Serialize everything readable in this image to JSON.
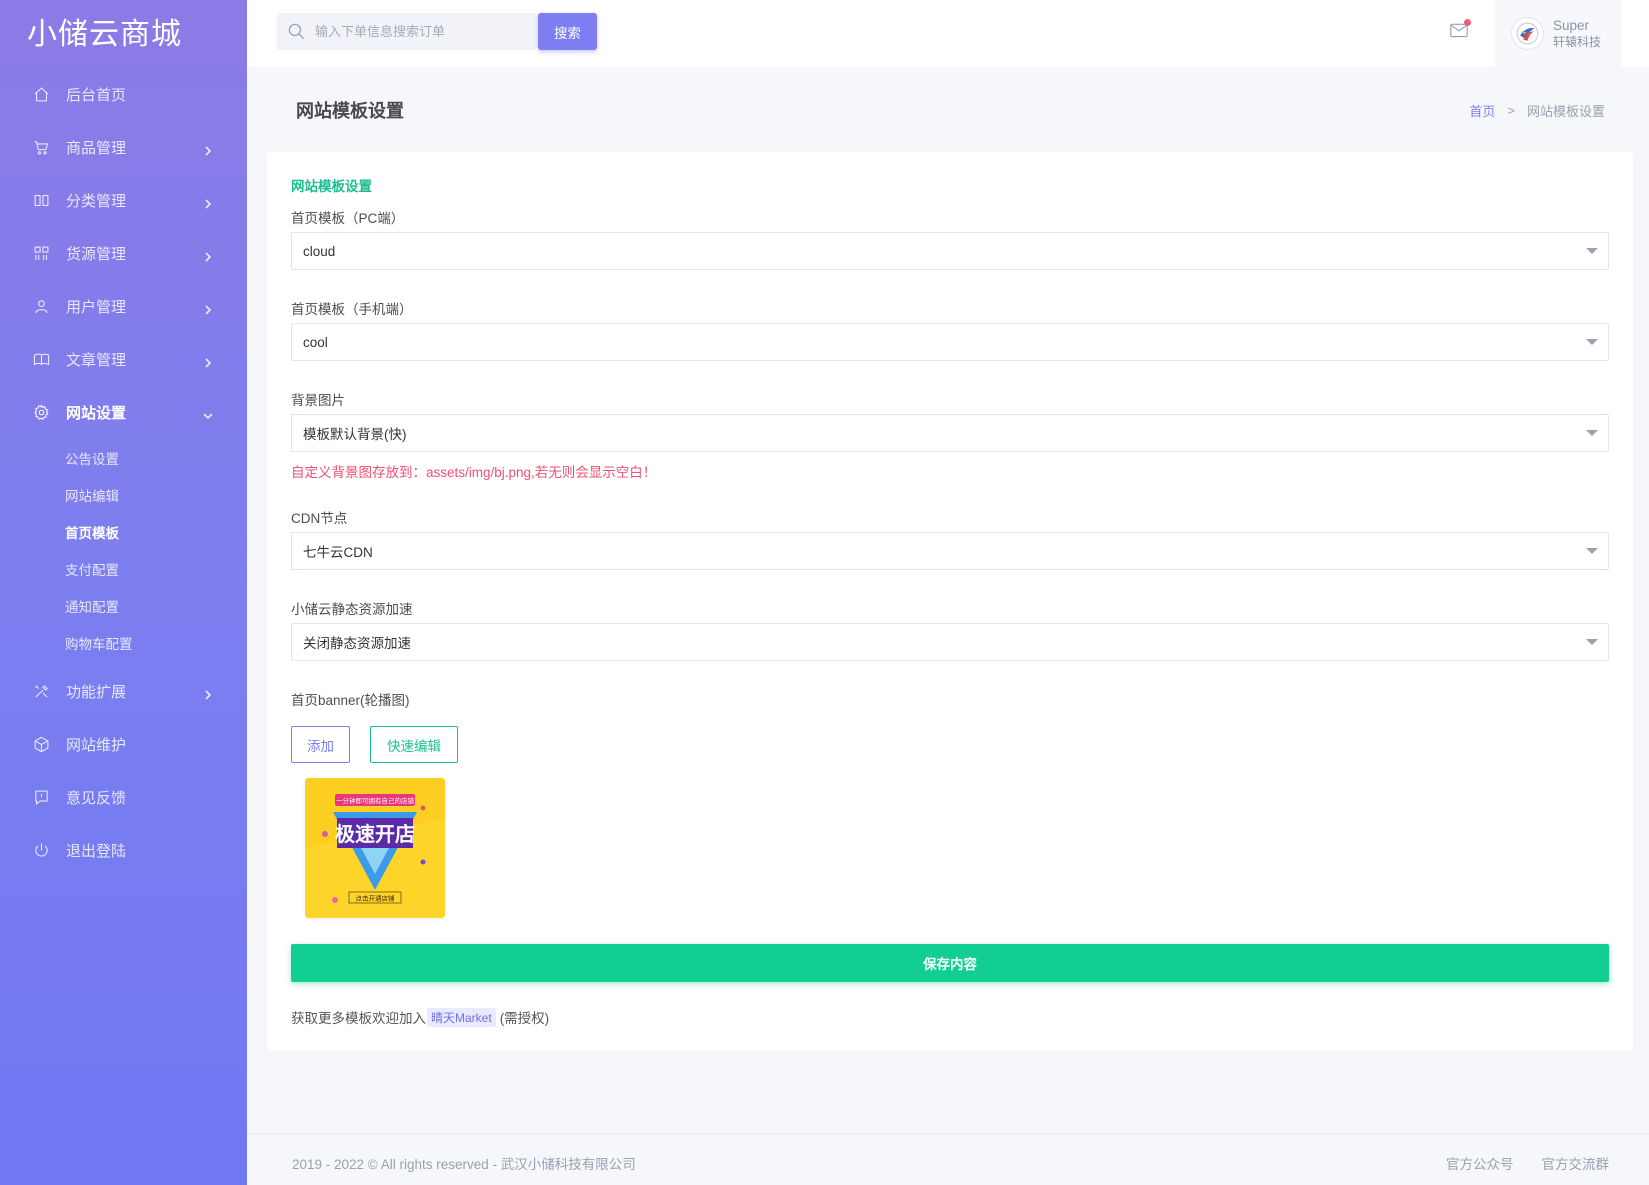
{
  "brand": "小储云商城",
  "sidebar": {
    "items": [
      {
        "label": "后台首页",
        "icon": "home-icon"
      },
      {
        "label": "商品管理",
        "icon": "cart-icon"
      },
      {
        "label": "分类管理",
        "icon": "columns-icon"
      },
      {
        "label": "货源管理",
        "icon": "grid-icon"
      },
      {
        "label": "用户管理",
        "icon": "user-icon"
      },
      {
        "label": "文章管理",
        "icon": "book-icon"
      },
      {
        "label": "网站设置",
        "icon": "gear-icon"
      },
      {
        "label": "功能扩展",
        "icon": "tools-icon"
      },
      {
        "label": "网站维护",
        "icon": "cube-icon"
      },
      {
        "label": "意见反馈",
        "icon": "feedback-icon"
      },
      {
        "label": "退出登陆",
        "icon": "power-icon"
      }
    ],
    "sub_items": [
      "公告设置",
      "网站编辑",
      "首页模板",
      "支付配置",
      "通知配置",
      "购物车配置"
    ]
  },
  "topbar": {
    "search_placeholder": "输入下单信息搜索订单",
    "search_button": "搜索",
    "user_name": "Super",
    "user_company": "轩辕科技"
  },
  "page": {
    "title": "网站模板设置",
    "breadcrumb_home": "首页",
    "breadcrumb_separator": ">",
    "breadcrumb_current": "网站模板设置"
  },
  "form": {
    "card_title": "网站模板设置",
    "pc_template_label": "首页模板（PC端）",
    "pc_template_value": "cloud",
    "mobile_template_label": "首页模板（手机端）",
    "mobile_template_value": "cool",
    "background_label": "背景图片",
    "background_value": "模板默认背景(快)",
    "background_hint": "自定义背景图存放到：assets/img/bj.png,若无则会显示空白！",
    "cdn_label": "CDN节点",
    "cdn_value": "七牛云CDN",
    "static_accel_label": "小储云静态资源加速",
    "static_accel_value": "关闭静态资源加速",
    "banner_label": "首页banner(轮播图)",
    "add_button": "添加",
    "quick_edit_button": "快速编辑",
    "banner_image": {
      "top_text": "一分钟即可拥有自己的店铺",
      "main_text": "极速开店",
      "bottom_text": "点击开通店铺"
    },
    "save_button": "保存内容",
    "more_prefix": "获取更多模板欢迎加入",
    "market_tag": "晴天Market",
    "more_suffix": "(需授权)"
  },
  "footer": {
    "copyright": "2019 - 2022 © All rights reserved - 武汉小储科技有限公司",
    "link_official_account": "官方公众号",
    "link_group": "官方交流群"
  },
  "colors": {
    "sidebar_top": "#8b7be6",
    "sidebar_bottom": "#7178f3",
    "accent": "#7c7ef2",
    "success": "#12ce93",
    "danger": "#ef5170"
  }
}
